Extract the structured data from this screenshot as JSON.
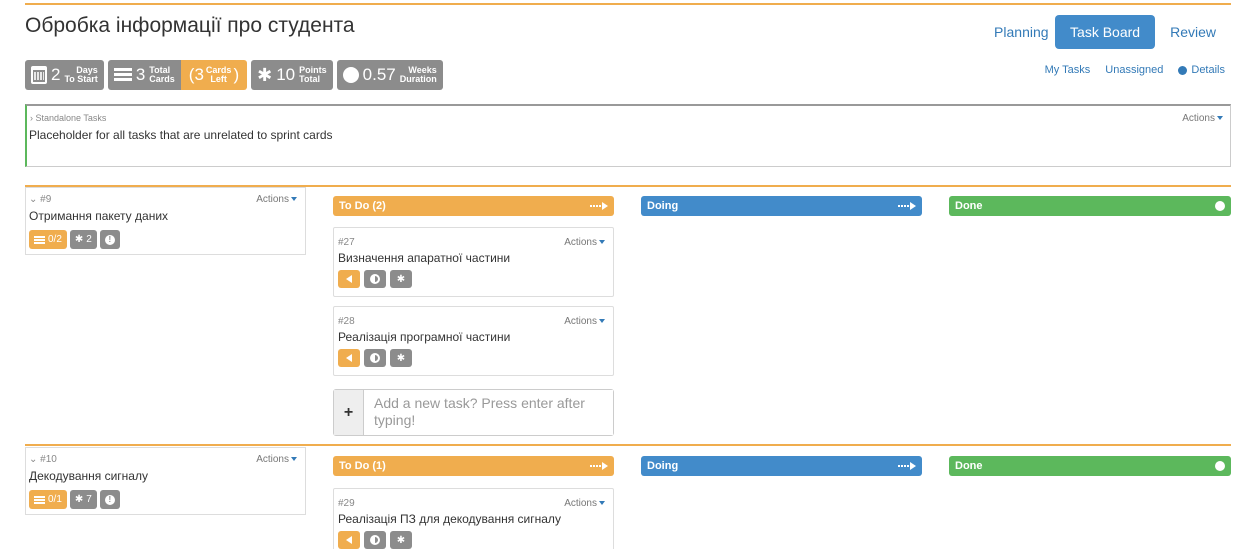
{
  "page": {
    "title": "Обробка інформації про студента"
  },
  "nav": {
    "planning": "Planning",
    "task_board": "Task Board",
    "review": "Review"
  },
  "stats": {
    "days": {
      "value": "2",
      "line1": "Days",
      "line2": "To Start"
    },
    "cards": {
      "value": "3",
      "line1": "Total",
      "line2": "Cards"
    },
    "cards_left": {
      "open": "(3",
      "line1": "Cards",
      "line2": "Left",
      "close": ")"
    },
    "points": {
      "value": "10",
      "line1": "Points",
      "line2": "Total"
    },
    "weeks": {
      "value": "0.57",
      "line1": "Weeks",
      "line2": "Duration"
    }
  },
  "sublinks": {
    "my_tasks": "My Tasks",
    "unassigned": "Unassigned",
    "details": "Details"
  },
  "standalone": {
    "heading": "› Standalone Tasks",
    "actions": "Actions",
    "text": "Placeholder for all tasks that are unrelated to sprint cards"
  },
  "stories": [
    {
      "id": "⌄ #9",
      "title": "Отримання пакету даних",
      "actions": "Actions",
      "tasks_badge": "0/2",
      "points_badge": "2",
      "todo": "To Do (2)",
      "doing": "Doing",
      "done": "Done",
      "tasks": [
        {
          "id": "#27",
          "title": "Визначення апаратної частини",
          "actions": "Actions"
        },
        {
          "id": "#28",
          "title": "Реалізація програмної частини",
          "actions": "Actions"
        }
      ]
    },
    {
      "id": "⌄ #10",
      "title": "Декодування сигналу",
      "actions": "Actions",
      "tasks_badge": "0/1",
      "points_badge": "7",
      "todo": "To Do (1)",
      "doing": "Doing",
      "done": "Done",
      "tasks": [
        {
          "id": "#29",
          "title": "Реалізація ПЗ для декодування сигналу",
          "actions": "Actions"
        }
      ]
    }
  ],
  "add_task": {
    "placeholder": "Add a new task? Press enter after typing!",
    "plus": "+"
  },
  "icons": {
    "star": "✱",
    "warning": "!"
  },
  "colors": {
    "accent": "#f0ad4e",
    "primary": "#428bca",
    "success": "#5cb85c",
    "muted": "#8c8c8c"
  }
}
